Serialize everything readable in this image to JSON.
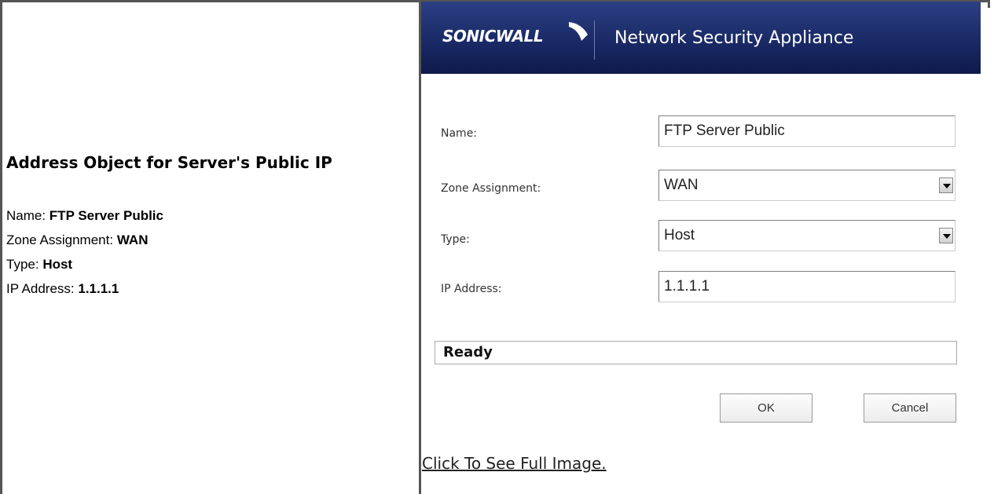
{
  "left": {
    "heading": "Address Object for Server's Public IP",
    "rows": [
      {
        "label": "Name: ",
        "value": "FTP Server Public"
      },
      {
        "label": "Zone Assignment: ",
        "value": "WAN"
      },
      {
        "label": "Type: ",
        "value": "Host"
      },
      {
        "label": "IP Address: ",
        "value": "1.1.1.1"
      }
    ]
  },
  "app": {
    "logo": "SONICWALL",
    "title": "Network Security Appliance",
    "fields": {
      "name": {
        "label": "Name:",
        "value": "FTP Server Public"
      },
      "zone": {
        "label": "Zone Assignment:",
        "value": "WAN"
      },
      "type": {
        "label": "Type:",
        "value": "Host"
      },
      "ip": {
        "label": "IP Address:",
        "value": "1.1.1.1"
      }
    },
    "status": "Ready",
    "ok_label": "OK",
    "cancel_label": "Cancel"
  },
  "link_text": "Click To See Full Image.",
  "colors": {
    "banner": "#1a2a66",
    "frame": "#555555"
  }
}
